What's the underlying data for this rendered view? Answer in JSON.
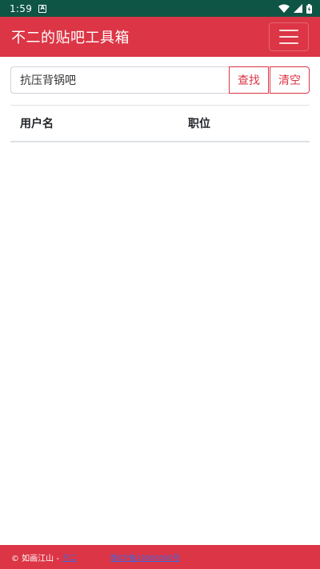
{
  "status_bar": {
    "time": "1:59",
    "notification_letter": "A",
    "icons": [
      "wifi-icon",
      "signal-icon",
      "battery-charging-icon"
    ]
  },
  "navbar": {
    "brand": "不二的贴吧工具箱",
    "menu_icon": "hamburger-icon"
  },
  "search": {
    "value": "抗压背锅吧",
    "search_label": "查找",
    "clear_label": "清空"
  },
  "table": {
    "headers": [
      "用户名",
      "职位"
    ],
    "rows": []
  },
  "footer": {
    "copyright": "© 如画江山 -",
    "author_link": "不二",
    "icp_link": "赣ICP备19000000号"
  },
  "colors": {
    "primary": "#dc3545",
    "status_bar": "#0e5546"
  }
}
